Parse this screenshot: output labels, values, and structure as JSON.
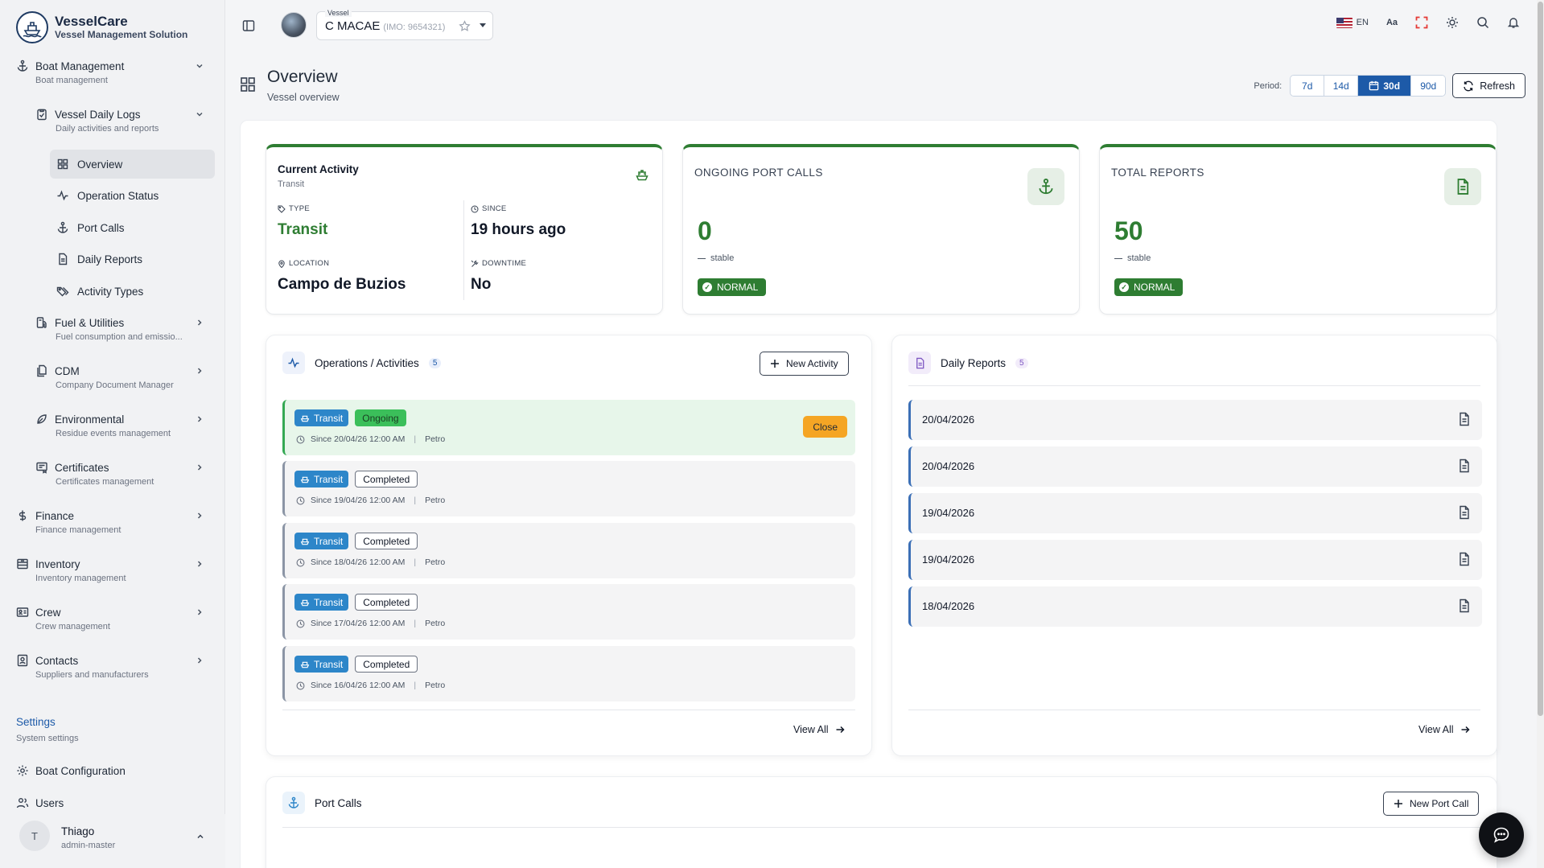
{
  "brand": {
    "title": "VesselCare",
    "subtitle": "Vessel Management Solution"
  },
  "sidebar": {
    "groups": [
      {
        "label": "Boat Management",
        "sub": "Boat management",
        "icon": "anchor-icon"
      },
      {
        "label": "Vessel Daily Logs",
        "sub": "Daily activities and reports",
        "icon": "clipboard-icon"
      },
      {
        "label": "Fuel & Utilities",
        "sub": "Fuel consumption and emissio...",
        "icon": "fuel-icon"
      },
      {
        "label": "CDM",
        "sub": "Company Document Manager",
        "icon": "documents-icon"
      },
      {
        "label": "Environmental",
        "sub": "Residue events management",
        "icon": "leaf-icon"
      },
      {
        "label": "Certificates",
        "sub": "Certificates management",
        "icon": "certificate-icon"
      },
      {
        "label": "Finance",
        "sub": "Finance management",
        "icon": "dollar-icon"
      },
      {
        "label": "Inventory",
        "sub": "Inventory management",
        "icon": "inventory-icon"
      },
      {
        "label": "Crew",
        "sub": "Crew management",
        "icon": "id-card-icon"
      },
      {
        "label": "Contacts",
        "sub": "Suppliers and manufacturers",
        "icon": "contacts-icon"
      }
    ],
    "daily_logs_items": [
      {
        "label": "Overview",
        "icon": "grid-icon"
      },
      {
        "label": "Operation Status",
        "icon": "activity-icon"
      },
      {
        "label": "Port Calls",
        "icon": "anchor-icon"
      },
      {
        "label": "Daily Reports",
        "icon": "file-icon"
      },
      {
        "label": "Activity Types",
        "icon": "tags-icon"
      }
    ],
    "settings": {
      "title": "Settings",
      "sub": "System settings"
    },
    "settings_items": [
      {
        "label": "Boat Configuration",
        "icon": "cog-icon"
      },
      {
        "label": "Users",
        "icon": "users-icon"
      }
    ],
    "user": {
      "initial": "T",
      "name": "Thiago",
      "role": "admin-master"
    }
  },
  "topbar": {
    "vessel_label": "Vessel",
    "vessel_name": "C MACAE",
    "vessel_imo": "(IMO: 9654321)",
    "language": "EN",
    "font_size_label": "Aa"
  },
  "page": {
    "title": "Overview",
    "subtitle": "Vessel overview"
  },
  "period": {
    "label": "Period:",
    "options": [
      "7d",
      "14d",
      "30d",
      "90d"
    ],
    "selected": "30d",
    "refresh_label": "Refresh"
  },
  "current_activity": {
    "title": "Current Activity",
    "subtitle": "Transit",
    "type_label": "TYPE",
    "type_value": "Transit",
    "since_label": "SINCE",
    "since_value": "19 hours ago",
    "location_label": "LOCATION",
    "location_value": "Campo de Buzios",
    "downtime_label": "DOWNTIME",
    "downtime_value": "No"
  },
  "kpis": [
    {
      "title": "ONGOING PORT CALLS",
      "value": "0",
      "trend": "stable",
      "status": "NORMAL",
      "icon": "anchor-icon"
    },
    {
      "title": "TOTAL REPORTS",
      "value": "50",
      "trend": "stable",
      "status": "NORMAL",
      "icon": "document-icon"
    }
  ],
  "operations": {
    "title": "Operations / Activities",
    "count": "5",
    "new_label": "New Activity",
    "close_label": "Close",
    "view_all": "View All",
    "rows": [
      {
        "type": "Transit",
        "status": "Ongoing",
        "since": "Since 20/04/26 12:00 AM",
        "user": "Petro"
      },
      {
        "type": "Transit",
        "status": "Completed",
        "since": "Since 19/04/26 12:00 AM",
        "user": "Petro"
      },
      {
        "type": "Transit",
        "status": "Completed",
        "since": "Since 18/04/26 12:00 AM",
        "user": "Petro"
      },
      {
        "type": "Transit",
        "status": "Completed",
        "since": "Since 17/04/26 12:00 AM",
        "user": "Petro"
      },
      {
        "type": "Transit",
        "status": "Completed",
        "since": "Since 16/04/26 12:00 AM",
        "user": "Petro"
      }
    ]
  },
  "daily_reports": {
    "title": "Daily Reports",
    "count": "5",
    "view_all": "View All",
    "rows": [
      "20/04/2026",
      "20/04/2026",
      "19/04/2026",
      "19/04/2026",
      "18/04/2026"
    ]
  },
  "port_calls": {
    "title": "Port Calls",
    "new_label": "New Port Call"
  },
  "colors": {
    "accent": "#1d5aa8",
    "success": "#2e7d32",
    "transit": "#2d86c9",
    "warning": "#f5a524"
  }
}
